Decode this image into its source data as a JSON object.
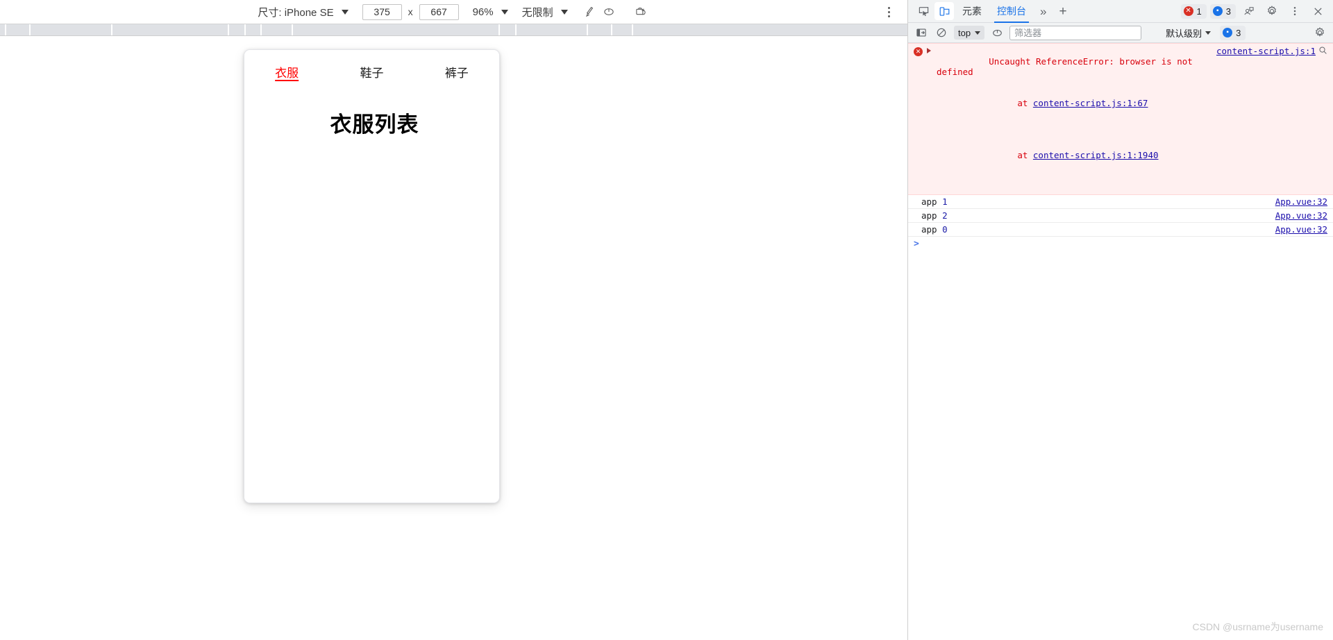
{
  "device_toolbar": {
    "size_label": "尺寸: iPhone SE",
    "width_value": "375",
    "x_separator": "x",
    "height_value": "667",
    "zoom_label": "96%",
    "throttle_label": "无限制",
    "icons": {
      "rotate": "rotate-icon",
      "cast": "cast-icon",
      "screenshot": "screenshot-icon",
      "kebab": "more-options-icon"
    }
  },
  "mobile_app": {
    "tabs": [
      {
        "label": "衣服",
        "active": true
      },
      {
        "label": "鞋子",
        "active": false
      },
      {
        "label": "裤子",
        "active": false
      }
    ],
    "heading": "衣服列表",
    "active_color": "#ff0000"
  },
  "devtools": {
    "toolbar_icons": {
      "inspect": "inspect-element-icon",
      "device": "toggle-device-toolbar-icon"
    },
    "tabs": [
      {
        "label": "元素",
        "active": false
      },
      {
        "label": "控制台",
        "active": true
      }
    ],
    "more_tabs": "»",
    "add_tab": "+",
    "error_badge": {
      "icon": "error-circle-icon",
      "count": "1"
    },
    "message_badge": {
      "icon": "message-circle-icon",
      "count": "3"
    },
    "right_icons": {
      "devices": "devices-icon",
      "settings": "gear-icon",
      "more": "more-options-icon",
      "close": "close-icon"
    }
  },
  "console": {
    "toolbar": {
      "sidebar_icon": "show-console-sidebar-icon",
      "clear_icon": "clear-console-icon",
      "context": "top",
      "eye_icon": "live-expression-icon",
      "filter_placeholder": "筛选器",
      "filter_value": "",
      "level": "默认级别",
      "message_badge": {
        "icon": "message-circle-icon",
        "count": "3"
      },
      "settings_icon": "gear-icon"
    },
    "error": {
      "icon": "error-circle-icon",
      "message": "Uncaught ReferenceError: browser is not defined",
      "source_link": "content-script.js:1",
      "stack": [
        {
          "prefix": "at ",
          "link": "content-script.js:1:67"
        },
        {
          "prefix": "at ",
          "link": "content-script.js:1:1940"
        }
      ],
      "search_icon": "search-in-page-icon"
    },
    "logs": [
      {
        "label": "app",
        "value": "1",
        "source": "App.vue:32"
      },
      {
        "label": "app",
        "value": "2",
        "source": "App.vue:32"
      },
      {
        "label": "app",
        "value": "0",
        "source": "App.vue:32"
      }
    ],
    "prompt": ">"
  },
  "watermark": "CSDN @usrname为username",
  "ruler_ticks": [
    7,
    42,
    160,
    328,
    375,
    420,
    845,
    880,
    910
  ]
}
